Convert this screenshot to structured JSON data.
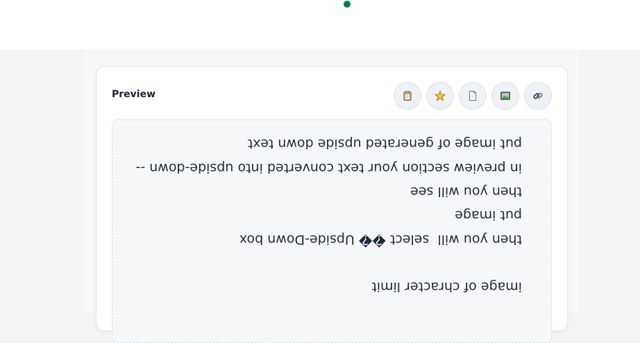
{
  "preview": {
    "title": "Preview",
    "lines": [
      "put image of generated upside down text",
      "in preview section your text converted into upside-down --",
      "then you will see",
      "put image",
      "then you will  select �� Upside-Down box",
      "",
      "image of chracter limit"
    ]
  },
  "toolbar": {
    "buttons": [
      {
        "name": "clipboard-icon",
        "title": "Copy"
      },
      {
        "name": "star-icon",
        "title": "Favorite"
      },
      {
        "name": "document-icon",
        "title": "Text"
      },
      {
        "name": "image-icon",
        "title": "Image"
      },
      {
        "name": "link-icon",
        "title": "Link"
      }
    ]
  },
  "colors": {
    "accent_dot": "#0a7a55",
    "text": "#1f2937",
    "card_border": "#e4e6ea"
  }
}
